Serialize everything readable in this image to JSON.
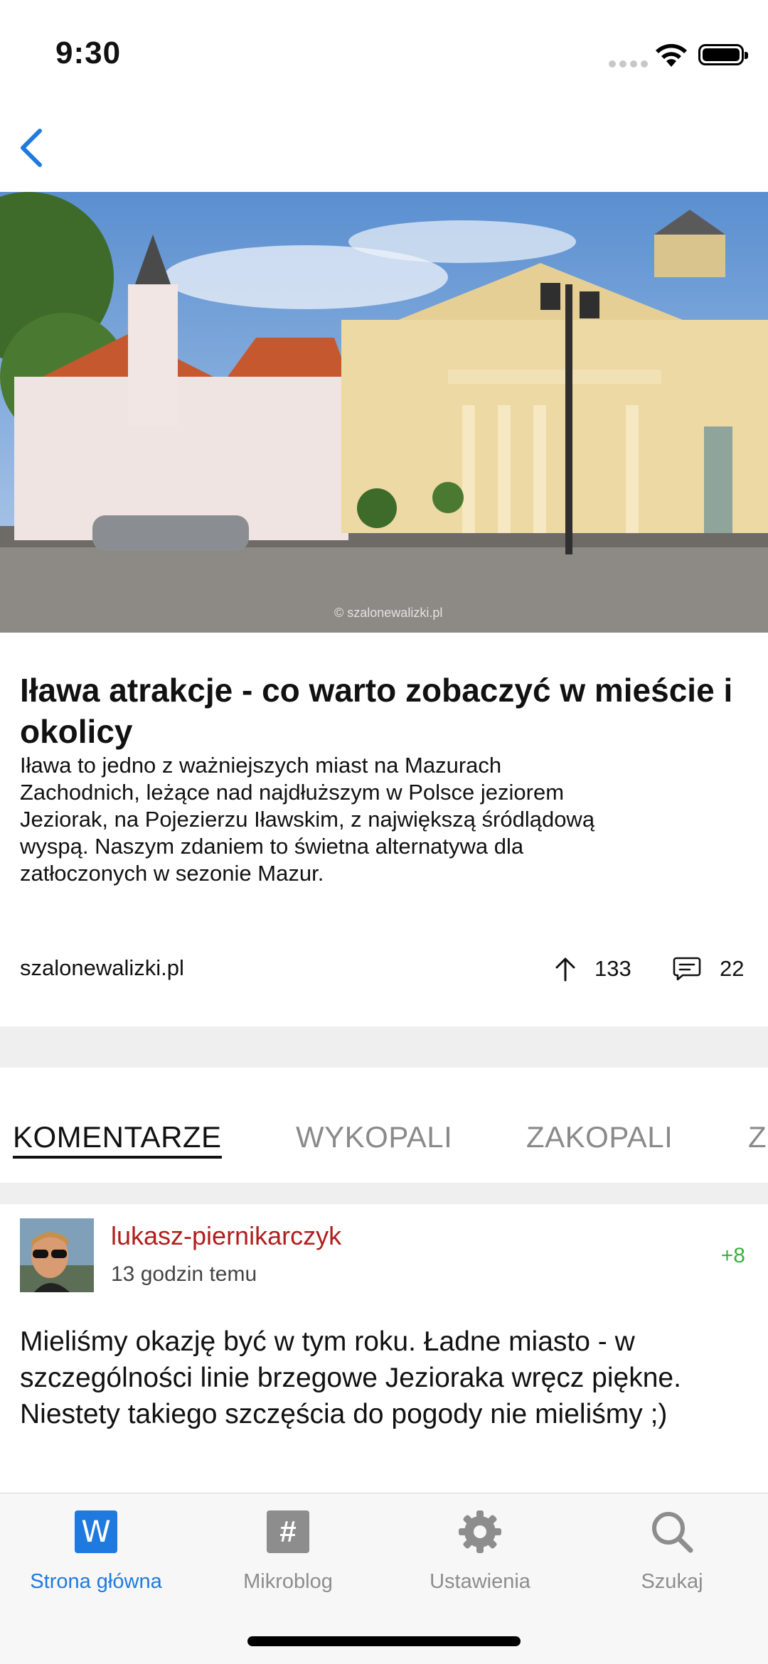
{
  "status_bar": {
    "time": "9:30"
  },
  "nav": {
    "back_icon": "chevron-left-icon"
  },
  "hero": {
    "watermark": "© szalonewalizki.pl"
  },
  "article": {
    "title": "Iława atrakcje - co warto zobaczyć w mieście i okolicy",
    "description": "Iława to jedno z ważniejszych miast na Mazurach Zachodnich, leżące nad najdłuższym w Polsce jeziorem Jeziorak, na Pojezierzu Iławskim, z największą śródlądową wyspą. Naszym zdaniem to świetna alternatywa dla zatłoczonych w sezonie Mazur.",
    "source": "szalonewalizki.pl",
    "votes": "133",
    "comments": "22"
  },
  "tabs": [
    {
      "label": "KOMENTARZE",
      "active": true
    },
    {
      "label": "WYKOPALI",
      "active": false
    },
    {
      "label": "ZAKOPALI",
      "active": false
    },
    {
      "label": "Z",
      "active": false
    }
  ],
  "comment": {
    "author": "lukasz-piernikarczyk",
    "time": "13 godzin temu",
    "score": "+8",
    "body": "Mieliśmy okazję być w tym roku. Ładne miasto - w szczególności linie brzegowe Jezioraka wręcz piękne. Niestety takiego szczęścia do pogody nie mieliśmy ;)"
  },
  "tab_bar": {
    "items": [
      {
        "label": "Strona główna",
        "icon": "wykop-w-icon",
        "active": true
      },
      {
        "label": "Mikroblog",
        "icon": "hashtag-icon",
        "active": false
      },
      {
        "label": "Ustawienia",
        "icon": "gear-icon",
        "active": false
      },
      {
        "label": "Szukaj",
        "icon": "search-icon",
        "active": false
      }
    ],
    "home_w": "W",
    "hash": "#"
  },
  "colors": {
    "accent": "#1f7ae0",
    "author": "#b21d1d",
    "score": "#3cb043"
  }
}
